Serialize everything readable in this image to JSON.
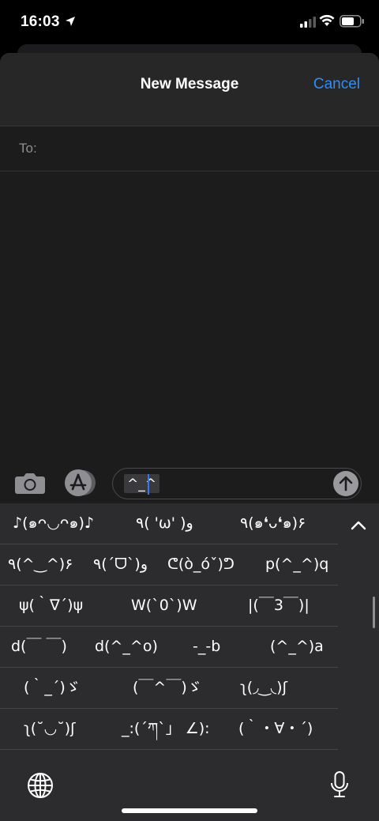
{
  "status_bar": {
    "time": "16:03"
  },
  "nav": {
    "title": "New Message",
    "cancel_label": "Cancel"
  },
  "recipient": {
    "label": "To:"
  },
  "compose": {
    "text": "^_^"
  },
  "keyboard": {
    "rows": [
      [
        "♪(๑ᴖ◡ᴖ๑)♪",
        "٩( 'ω' )و",
        "٩(๑❛ᴗ❛๑)۶"
      ],
      [
        "٩(^‿^)۶",
        "٩(ˊᗜˋ)و",
        "ᕦ(ò_óˇ)ᕤ",
        "p(^_^)q"
      ],
      [
        "ψ(｀∇´)ψ",
        "W(`0`)W",
        "|(￣3￣)|"
      ],
      [
        "d(￣ ￣)",
        "d(^_^o)",
        "-_-b",
        "(^_^)a"
      ],
      [
        "(｀_´)ゞ",
        "(￣^￣)ゞ",
        "ʅ(◞‿◟)ʃ"
      ],
      [
        "ʅ(˘◡˘)ʃ",
        "_:(´ཀ`」 ∠):",
        "(｀・∀・´)"
      ]
    ]
  }
}
